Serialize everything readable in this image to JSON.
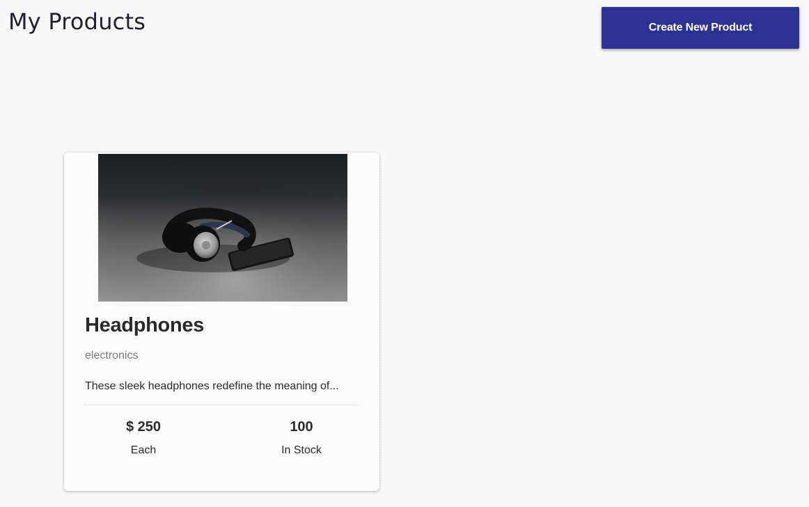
{
  "header": {
    "title": "My Products",
    "create_button_label": "Create New Product"
  },
  "products": [
    {
      "name": "Headphones",
      "category": "electronics",
      "description": "These sleek headphones redefine the meaning of...",
      "price": "$ 250",
      "price_label": "Each",
      "stock": "100",
      "stock_label": "In Stock",
      "image_icon": "headphones-photo"
    }
  ],
  "colors": {
    "accent": "#2d3192",
    "background": "#f9f9f9",
    "text": "#2a2a2a",
    "muted": "#7b7b7b"
  }
}
